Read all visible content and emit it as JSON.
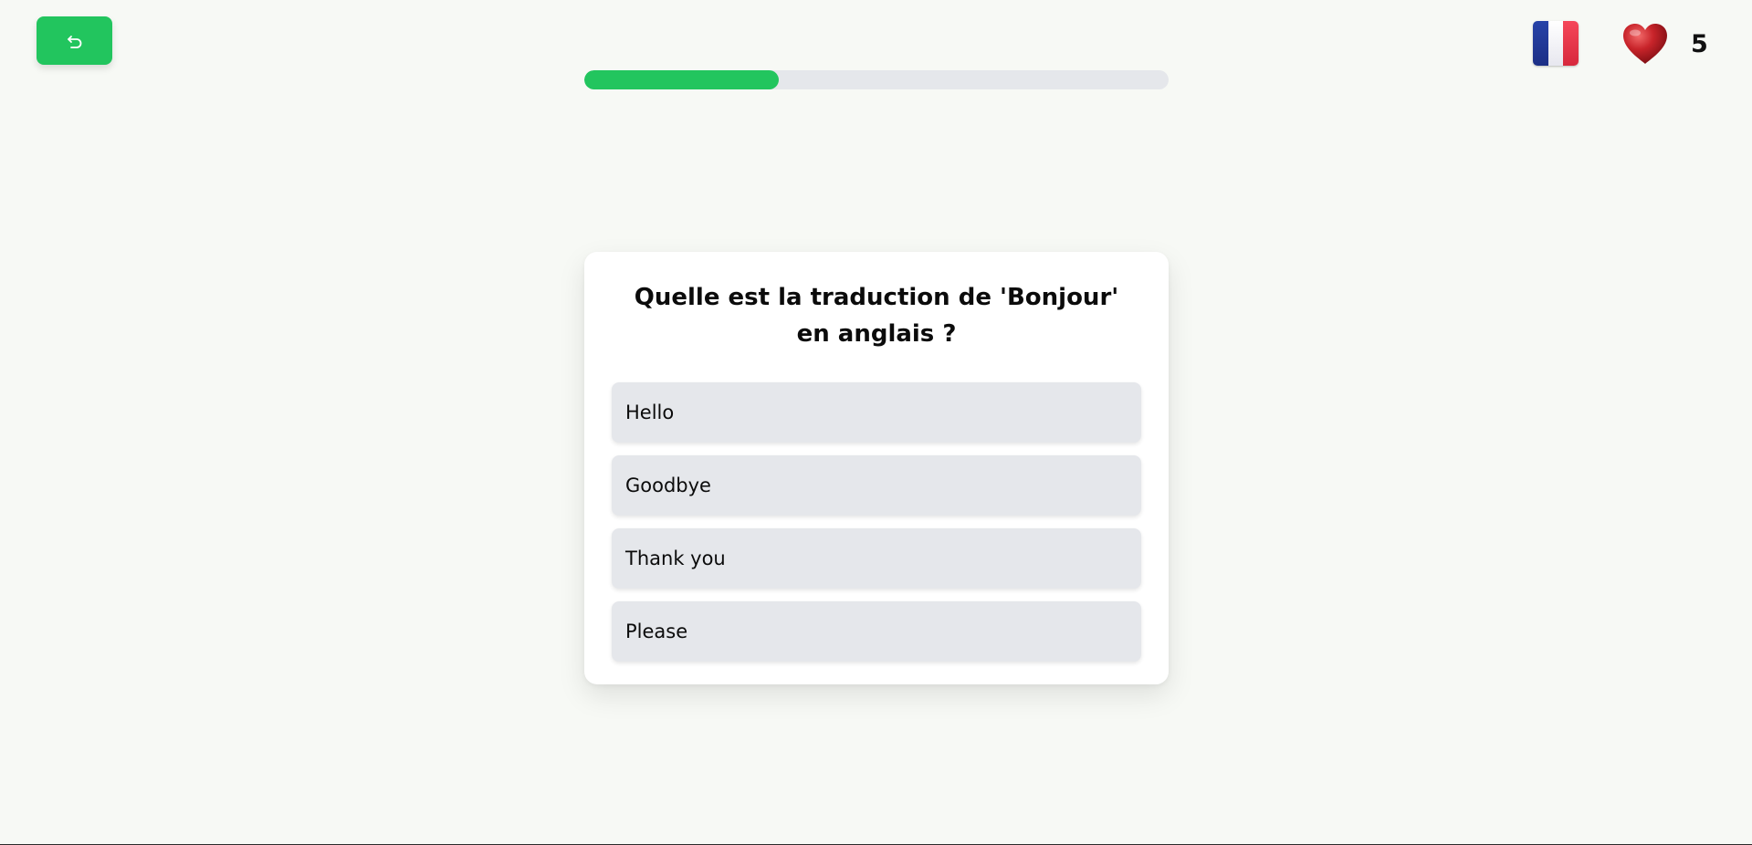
{
  "header": {
    "back_button": {
      "icon": "undo-arrow-icon",
      "color": "#22c55e"
    },
    "progress": {
      "value": 0.333,
      "fill_color": "#22c55e",
      "track_color": "#e5e7eb"
    },
    "language": {
      "icon": "flag-france-icon"
    },
    "lives": {
      "icon": "heart-icon",
      "count": "5"
    }
  },
  "quiz": {
    "question": "Quelle est la traduction de 'Bonjour' en anglais ?",
    "options": [
      {
        "label": "Hello"
      },
      {
        "label": "Goodbye"
      },
      {
        "label": "Thank you"
      },
      {
        "label": "Please"
      }
    ]
  },
  "colors": {
    "background": "#f7f9f5",
    "accent": "#22c55e",
    "option_background": "#e5e7eb"
  }
}
